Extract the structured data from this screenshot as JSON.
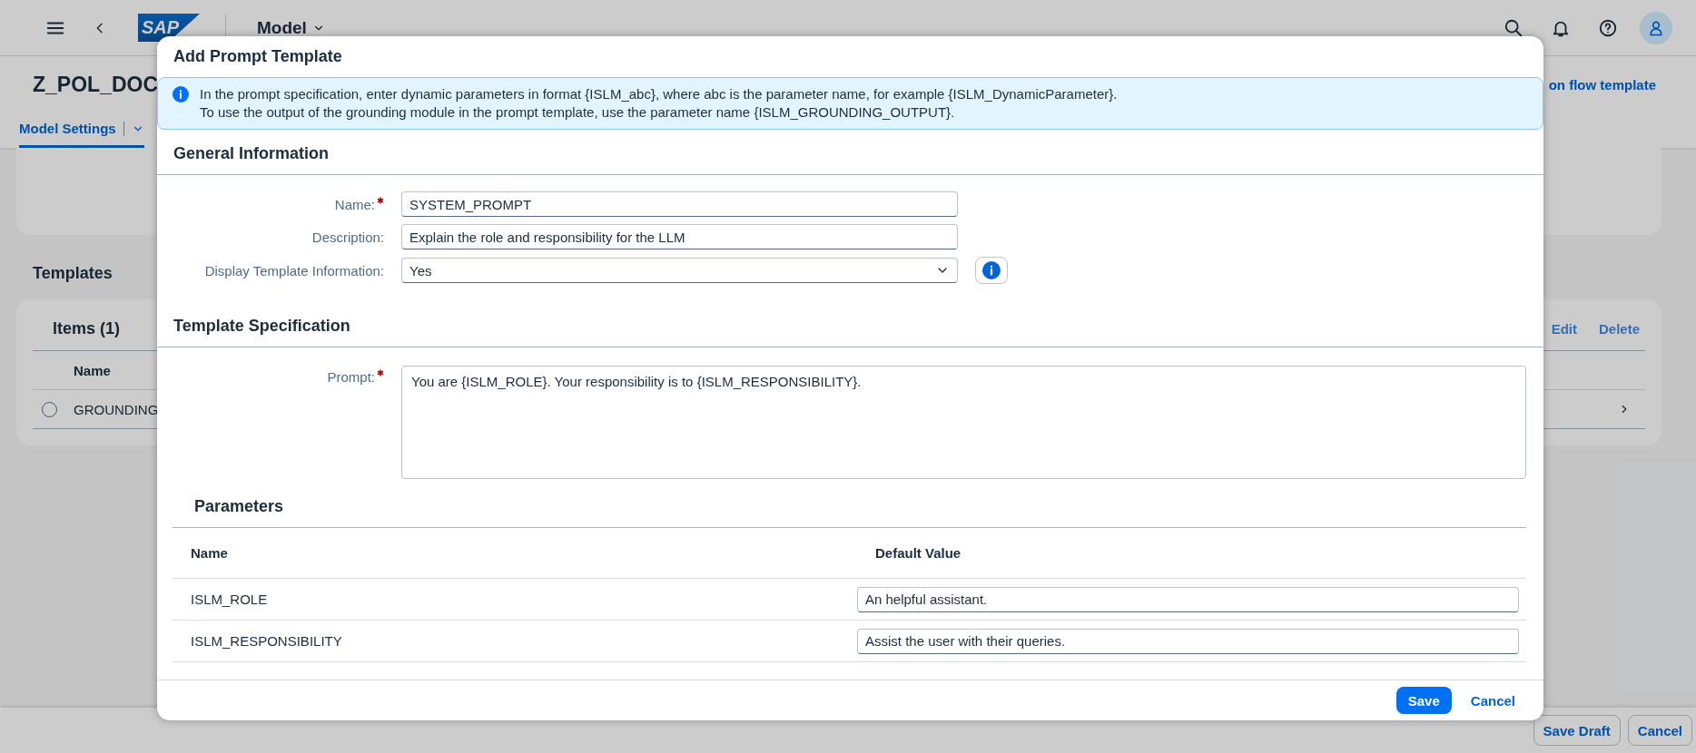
{
  "shell": {
    "logo_text": "SAP",
    "title": "Model"
  },
  "page": {
    "title": "Z_POL_DOC",
    "header_link": "on flow template",
    "tabs": [
      {
        "label": "Model Settings",
        "selected": true
      }
    ],
    "section_title": "Templates",
    "items_table": {
      "title": "Items (1)",
      "actions": [
        "Edit",
        "Delete"
      ],
      "columns": [
        "Name"
      ],
      "rows": [
        {
          "name": "GROUNDING",
          "selected": false
        }
      ]
    },
    "footer_buttons": [
      "Save Draft",
      "Cancel"
    ]
  },
  "dialog": {
    "title": "Add Prompt Template",
    "info_lines": [
      "In the prompt specification, enter dynamic parameters in format {ISLM_abc}, where abc is the parameter name, for example {ISLM_DynamicParameter}.",
      "To use the output of the grounding module in the prompt template, use the parameter name {ISLM_GROUNDING_OUTPUT}."
    ],
    "general_information": {
      "title": "General Information",
      "fields": [
        {
          "label": "Name:",
          "required": true,
          "value": "SYSTEM_PROMPT",
          "kind": "input"
        },
        {
          "label": "Description:",
          "required": false,
          "value": "Explain the role and responsibility for the LLM",
          "kind": "input"
        },
        {
          "label": "Display Template Information:",
          "required": false,
          "value": "Yes",
          "kind": "select"
        }
      ]
    },
    "template_specification": {
      "title": "Template Specification",
      "prompt": {
        "label": "Prompt:",
        "required": true,
        "value": "You are {ISLM_ROLE}. Your responsibility is to {ISLM_RESPONSIBILITY}."
      },
      "parameters": {
        "title": "Parameters",
        "columns": [
          "Name",
          "Default Value"
        ],
        "rows": [
          {
            "name": "ISLM_ROLE",
            "default_value": "An helpful assistant."
          },
          {
            "name": "ISLM_RESPONSIBILITY",
            "default_value": "Assist the user with their queries."
          }
        ]
      }
    },
    "buttons": [
      {
        "label": "Save",
        "kind": "emphasized"
      },
      {
        "label": "Cancel",
        "kind": "transparent"
      }
    ]
  }
}
